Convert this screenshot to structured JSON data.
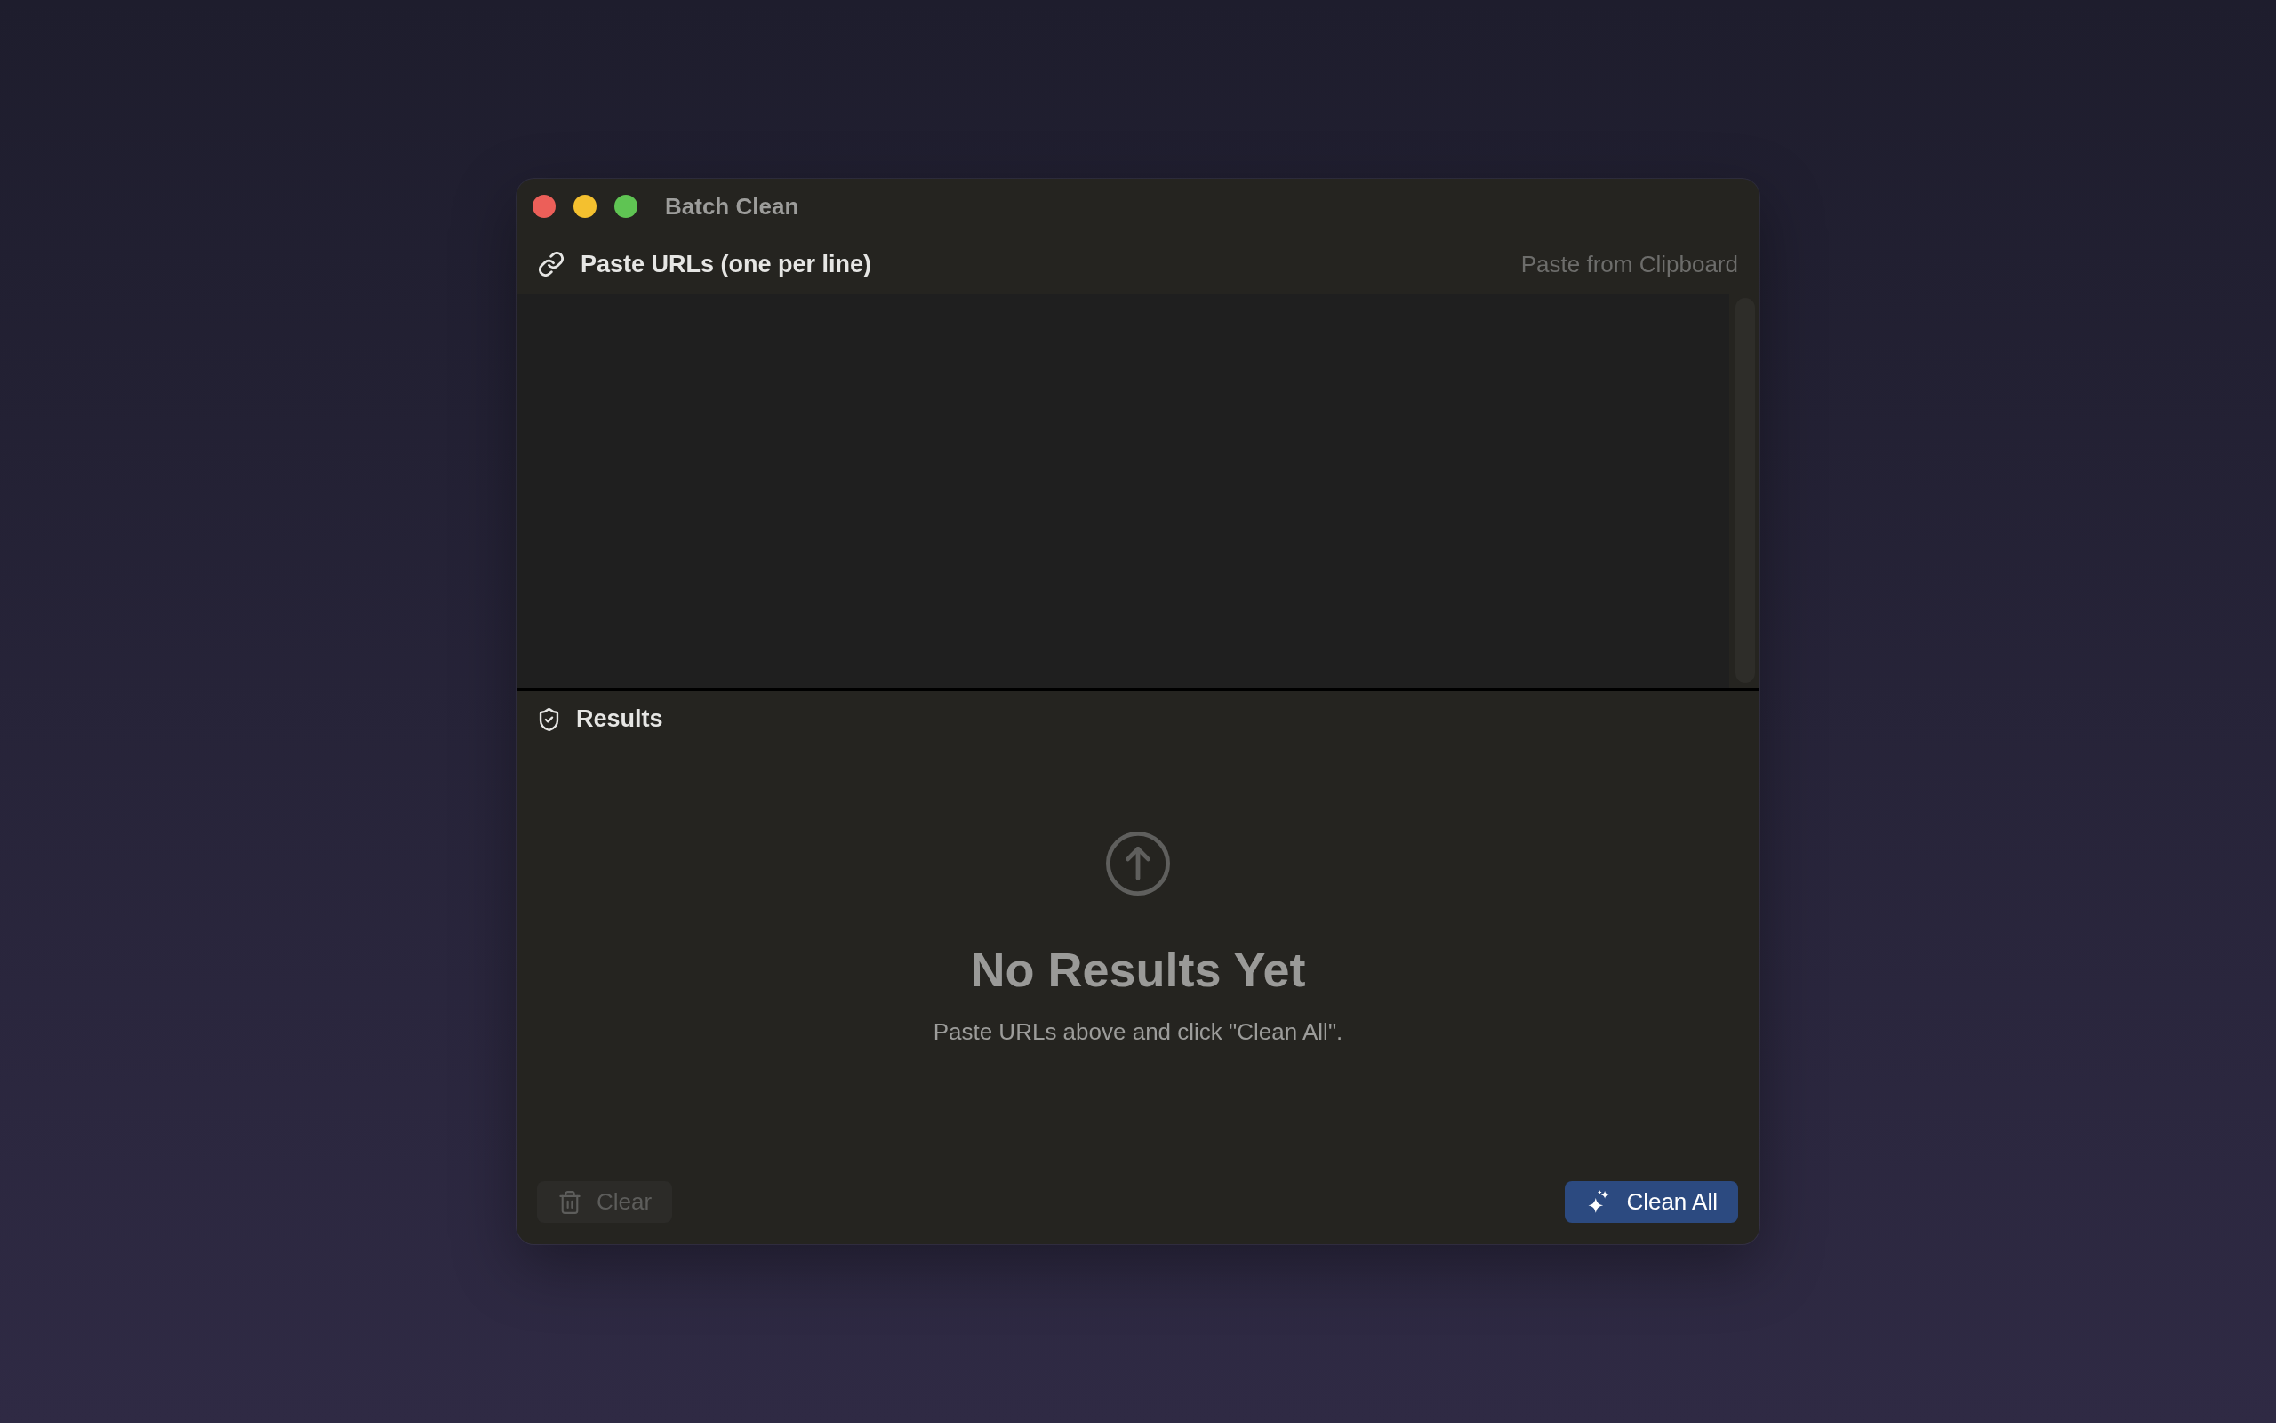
{
  "window": {
    "title": "Batch Clean"
  },
  "input": {
    "label": "Paste URLs (one per line)",
    "action": "Paste from Clipboard"
  },
  "results": {
    "label": "Results",
    "empty_title": "No Results Yet",
    "empty_message": "Paste URLs above and click \"Clean All\"."
  },
  "footer": {
    "buttons": [
      {
        "label": "Clear",
        "kind": "secondary",
        "disabled": true
      },
      {
        "label": "Clean All",
        "kind": "primary",
        "disabled": false
      }
    ]
  }
}
